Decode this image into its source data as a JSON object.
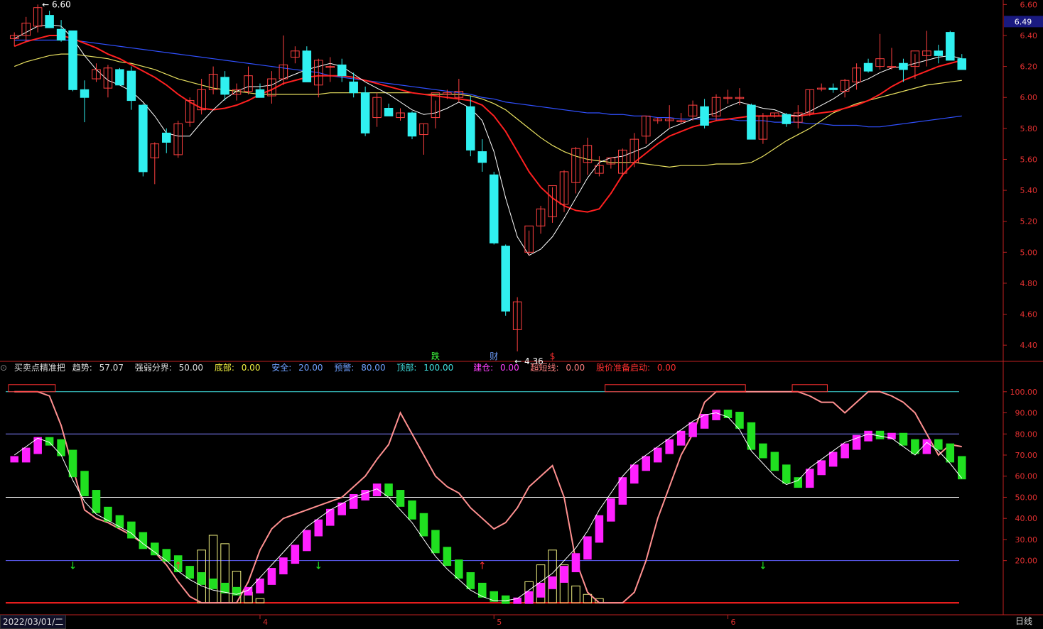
{
  "colors": {
    "background": "#000000",
    "axis": "#c02020",
    "candle_up": "#ff4040",
    "candle_down": "#30f0f0",
    "ma5": "#ffffff",
    "ma10": "#ff2020",
    "ma20": "#e8e060",
    "ma60": "#3050ff",
    "trend_up": "#ff20ff",
    "trend_down": "#20e020",
    "oscillator_line": "#ff9090",
    "signal_line": "#ffffff",
    "bottom_bars": "#f0f080"
  },
  "header": {
    "indicator_name": "买卖点精准把",
    "trend_label": "趋势:",
    "trend_value": "57.07",
    "strength_label": "强弱分界:",
    "strength_value": "50.00",
    "bottom_label": "底部:",
    "bottom_value": "0.00",
    "safe_label": "安全:",
    "safe_value": "20.00",
    "warn_label": "预警:",
    "warn_value": "80.00",
    "top_label": "顶部:",
    "top_value": "100.00",
    "build_label": "建仓:",
    "build_value": "0.00",
    "short_label": "超短线:",
    "short_value": "0.00",
    "launch_label": "股价准备启动:",
    "launch_value": "0.00"
  },
  "footer": {
    "start_date": "2022/03/01/二",
    "period": "日线"
  },
  "chart_data": [
    {
      "type": "candlestick",
      "ylim": [
        4.3,
        6.62
      ],
      "y_ticks": [
        "6.60",
        "6.40",
        "6.20",
        "6.00",
        "5.80",
        "5.60",
        "5.40",
        "5.20",
        "5.00",
        "4.80",
        "4.60",
        "4.40"
      ],
      "x_ticks": [
        "4",
        "5",
        "6"
      ],
      "last_price": "6.49",
      "high_label": "6.60",
      "low_label": "4.36",
      "markers": [
        "跌",
        "财",
        "$"
      ],
      "candles": [
        [
          6.38,
          6.42,
          6.33,
          6.4
        ],
        [
          6.4,
          6.52,
          6.36,
          6.48
        ],
        [
          6.46,
          6.6,
          6.42,
          6.58
        ],
        [
          6.53,
          6.56,
          6.45,
          6.45
        ],
        [
          6.44,
          6.5,
          6.36,
          6.37
        ],
        [
          6.43,
          6.43,
          6.04,
          6.05
        ],
        [
          6.05,
          6.11,
          5.84,
          6.0
        ],
        [
          6.12,
          6.22,
          6.1,
          6.18
        ],
        [
          6.06,
          6.21,
          6.0,
          6.19
        ],
        [
          6.18,
          6.19,
          6.08,
          6.08
        ],
        [
          6.17,
          6.2,
          5.92,
          5.98
        ],
        [
          5.95,
          5.96,
          5.49,
          5.52
        ],
        [
          5.61,
          5.71,
          5.44,
          5.7
        ],
        [
          5.77,
          5.8,
          5.64,
          5.71
        ],
        [
          5.63,
          5.85,
          5.61,
          5.83
        ],
        [
          5.84,
          6.0,
          5.81,
          5.98
        ],
        [
          5.92,
          6.12,
          5.89,
          6.05
        ],
        [
          6.05,
          6.2,
          6.02,
          6.15
        ],
        [
          6.13,
          6.17,
          5.98,
          6.02
        ],
        [
          6.02,
          6.09,
          5.98,
          6.05
        ],
        [
          6.04,
          6.2,
          6.02,
          6.14
        ],
        [
          6.05,
          6.09,
          6.0,
          6.0
        ],
        [
          6.01,
          6.17,
          5.96,
          6.12
        ],
        [
          6.12,
          6.4,
          6.08,
          6.21
        ],
        [
          6.26,
          6.33,
          6.22,
          6.3
        ],
        [
          6.3,
          6.33,
          6.1,
          6.1
        ],
        [
          6.08,
          6.25,
          6.0,
          6.24
        ],
        [
          6.2,
          6.26,
          6.1,
          6.2
        ],
        [
          6.21,
          6.25,
          6.1,
          6.14
        ],
        [
          6.1,
          6.16,
          6.0,
          6.03
        ],
        [
          6.03,
          6.07,
          5.75,
          5.77
        ],
        [
          5.87,
          6.03,
          5.81,
          6.0
        ],
        [
          5.93,
          5.96,
          5.88,
          5.88
        ],
        [
          5.87,
          5.93,
          5.85,
          5.9
        ],
        [
          5.9,
          5.91,
          5.73,
          5.75
        ],
        [
          5.76,
          5.83,
          5.63,
          5.83
        ],
        [
          5.87,
          5.98,
          5.8,
          6.03
        ],
        [
          6.02,
          6.05,
          5.99,
          6.03
        ],
        [
          6.0,
          6.12,
          5.97,
          6.04
        ],
        [
          5.94,
          6.01,
          5.62,
          5.66
        ],
        [
          5.65,
          5.73,
          5.52,
          5.58
        ],
        [
          5.5,
          5.52,
          5.05,
          5.06
        ],
        [
          5.04,
          5.05,
          4.59,
          4.62
        ],
        [
          4.5,
          4.71,
          4.36,
          4.68
        ],
        [
          5.0,
          5.14,
          4.98,
          5.17
        ],
        [
          5.17,
          5.3,
          5.12,
          5.28
        ],
        [
          5.23,
          5.42,
          5.19,
          5.43
        ],
        [
          5.31,
          5.53,
          5.26,
          5.52
        ],
        [
          5.45,
          5.68,
          5.38,
          5.67
        ],
        [
          5.58,
          5.74,
          5.5,
          5.69
        ],
        [
          5.51,
          5.62,
          5.49,
          5.56
        ],
        [
          5.57,
          5.61,
          5.54,
          5.61
        ],
        [
          5.51,
          5.67,
          5.49,
          5.66
        ],
        [
          5.58,
          5.77,
          5.55,
          5.73
        ],
        [
          5.75,
          5.88,
          5.7,
          5.88
        ],
        [
          5.85,
          5.87,
          5.83,
          5.86
        ],
        [
          5.85,
          5.95,
          5.8,
          5.86
        ],
        [
          5.85,
          5.9,
          5.83,
          5.85
        ],
        [
          5.88,
          5.98,
          5.85,
          5.95
        ],
        [
          5.94,
          5.99,
          5.8,
          5.82
        ],
        [
          5.88,
          6.02,
          5.85,
          6.0
        ],
        [
          6.0,
          6.05,
          5.96,
          6.0
        ],
        [
          6.0,
          6.06,
          5.95,
          6.0
        ],
        [
          5.95,
          5.96,
          5.74,
          5.73
        ],
        [
          5.73,
          5.9,
          5.7,
          5.88
        ],
        [
          5.88,
          5.9,
          5.87,
          5.9
        ],
        [
          5.89,
          5.9,
          5.81,
          5.83
        ],
        [
          5.84,
          5.95,
          5.8,
          5.9
        ],
        [
          5.9,
          6.05,
          5.88,
          6.05
        ],
        [
          6.06,
          6.09,
          6.04,
          6.06
        ],
        [
          6.06,
          6.09,
          6.03,
          6.05
        ],
        [
          6.04,
          6.12,
          6.0,
          6.11
        ],
        [
          6.1,
          6.22,
          6.05,
          6.19
        ],
        [
          6.22,
          6.25,
          6.16,
          6.17
        ],
        [
          6.2,
          6.41,
          6.18,
          6.25
        ],
        [
          6.2,
          6.32,
          6.18,
          6.2
        ],
        [
          6.22,
          6.25,
          6.1,
          6.18
        ],
        [
          6.2,
          6.28,
          6.12,
          6.3
        ],
        [
          6.27,
          6.43,
          6.2,
          6.3
        ],
        [
          6.3,
          6.34,
          6.22,
          6.27
        ],
        [
          6.42,
          6.43,
          6.26,
          6.24
        ],
        [
          6.25,
          6.28,
          6.19,
          6.18
        ]
      ],
      "ma5": [
        6.38,
        6.42,
        6.46,
        6.47,
        6.46,
        6.38,
        6.27,
        6.18,
        6.11,
        6.08,
        6.04,
        5.97,
        5.88,
        5.77,
        5.75,
        5.75,
        5.84,
        5.92,
        5.99,
        6.04,
        6.07,
        6.07,
        6.08,
        6.12,
        6.15,
        6.18,
        6.2,
        6.22,
        6.2,
        6.15,
        6.1,
        6.06,
        6.02,
        5.97,
        5.92,
        5.89,
        5.9,
        5.93,
        5.97,
        5.93,
        5.85,
        5.65,
        5.35,
        5.1,
        4.98,
        5.02,
        5.1,
        5.22,
        5.35,
        5.48,
        5.58,
        5.61,
        5.62,
        5.65,
        5.68,
        5.74,
        5.8,
        5.83,
        5.86,
        5.88,
        5.9,
        5.94,
        5.97,
        5.95,
        5.93,
        5.92,
        5.89,
        5.88,
        5.91,
        5.95,
        5.99,
        6.04,
        6.09,
        6.12,
        6.16,
        6.19,
        6.2,
        6.22,
        6.24,
        6.26,
        6.27,
        6.25
      ],
      "ma10": [
        6.33,
        6.36,
        6.38,
        6.4,
        6.4,
        6.38,
        6.35,
        6.32,
        6.28,
        6.25,
        6.21,
        6.17,
        6.13,
        6.08,
        6.02,
        5.97,
        5.93,
        5.92,
        5.93,
        5.95,
        5.98,
        6.02,
        6.05,
        6.09,
        6.11,
        6.13,
        6.14,
        6.14,
        6.14,
        6.13,
        6.11,
        6.09,
        6.07,
        6.05,
        6.03,
        6.02,
        6.01,
        6.0,
        5.99,
        5.98,
        5.95,
        5.88,
        5.78,
        5.65,
        5.52,
        5.42,
        5.35,
        5.3,
        5.27,
        5.26,
        5.28,
        5.38,
        5.5,
        5.58,
        5.64,
        5.7,
        5.75,
        5.78,
        5.81,
        5.83,
        5.85,
        5.86,
        5.87,
        5.88,
        5.88,
        5.88,
        5.88,
        5.88,
        5.89,
        5.9,
        5.91,
        5.93,
        5.95,
        5.98,
        6.02,
        6.07,
        6.11,
        6.14,
        6.17,
        6.2,
        6.22,
        6.24
      ],
      "ma20": [
        6.2,
        6.23,
        6.25,
        6.27,
        6.28,
        6.28,
        6.27,
        6.26,
        6.25,
        6.23,
        6.22,
        6.2,
        6.18,
        6.15,
        6.12,
        6.1,
        6.08,
        6.06,
        6.05,
        6.04,
        6.03,
        6.02,
        6.02,
        6.02,
        6.02,
        6.02,
        6.02,
        6.03,
        6.03,
        6.03,
        6.03,
        6.03,
        6.03,
        6.03,
        6.03,
        6.02,
        6.02,
        6.02,
        6.02,
        6.01,
        5.99,
        5.96,
        5.92,
        5.86,
        5.8,
        5.74,
        5.69,
        5.65,
        5.62,
        5.6,
        5.59,
        5.58,
        5.58,
        5.58,
        5.57,
        5.56,
        5.55,
        5.56,
        5.56,
        5.56,
        5.57,
        5.57,
        5.57,
        5.58,
        5.62,
        5.67,
        5.72,
        5.76,
        5.8,
        5.85,
        5.9,
        5.93,
        5.96,
        5.98,
        6.0,
        6.02,
        6.04,
        6.06,
        6.08,
        6.09,
        6.1,
        6.11
      ],
      "ma60": [
        6.37,
        6.37,
        6.37,
        6.37,
        6.37,
        6.37,
        6.36,
        6.35,
        6.34,
        6.33,
        6.32,
        6.31,
        6.3,
        6.29,
        6.28,
        6.27,
        6.26,
        6.25,
        6.24,
        6.23,
        6.22,
        6.21,
        6.2,
        6.19,
        6.18,
        6.17,
        6.16,
        6.14,
        6.13,
        6.12,
        6.11,
        6.1,
        6.09,
        6.08,
        6.07,
        6.06,
        6.05,
        6.04,
        6.03,
        6.02,
        6.0,
        5.99,
        5.97,
        5.96,
        5.95,
        5.94,
        5.93,
        5.92,
        5.91,
        5.9,
        5.9,
        5.89,
        5.89,
        5.88,
        5.88,
        5.87,
        5.87,
        5.86,
        5.86,
        5.86,
        5.86,
        5.86,
        5.85,
        5.85,
        5.85,
        5.84,
        5.84,
        5.84,
        5.83,
        5.83,
        5.82,
        5.82,
        5.82,
        5.81,
        5.81,
        5.82,
        5.83,
        5.84,
        5.85,
        5.86,
        5.87,
        5.88
      ]
    },
    {
      "type": "bar",
      "ylim": [
        -5,
        108
      ],
      "y_ticks": [
        "100.00",
        "90.00",
        "80.00",
        "70.00",
        "60.00",
        "50.00",
        "40.00",
        "30.00",
        "20.00"
      ],
      "reference_levels": [
        0,
        20,
        50,
        80,
        100
      ],
      "trend": [
        68,
        72,
        77,
        76,
        71,
        61,
        52,
        44,
        40,
        37,
        32,
        27,
        24,
        21,
        16,
        13,
        10,
        8,
        6,
        5,
        6,
        10,
        15,
        20,
        26,
        33,
        38,
        43,
        46,
        50,
        52,
        55,
        52,
        47,
        41,
        33,
        25,
        19,
        13,
        8,
        4,
        2,
        1,
        1,
        4,
        8,
        11,
        16,
        22,
        30,
        40,
        48,
        58,
        64,
        68,
        72,
        76,
        80,
        84,
        88,
        90,
        89,
        84,
        74,
        70,
        64,
        58,
        56,
        62,
        66,
        70,
        74,
        78,
        80,
        79,
        79,
        76,
        72,
        76,
        74,
        68,
        60
      ],
      "oscillator": [
        100,
        100,
        100,
        98,
        84,
        64,
        44,
        40,
        38,
        35,
        32,
        28,
        24,
        18,
        10,
        3,
        0,
        0,
        0,
        0,
        10,
        25,
        35,
        40,
        42,
        44,
        46,
        48,
        50,
        55,
        60,
        68,
        75,
        90,
        80,
        70,
        60,
        55,
        52,
        45,
        40,
        35,
        38,
        45,
        55,
        60,
        65,
        50,
        20,
        5,
        0,
        0,
        0,
        5,
        20,
        40,
        55,
        70,
        80,
        95,
        100,
        100,
        100,
        100,
        100,
        100,
        100,
        100,
        98,
        95,
        95,
        90,
        95,
        100,
        100,
        98,
        95,
        90,
        80,
        70,
        75,
        74
      ],
      "signal": [
        70,
        74,
        78,
        76,
        70,
        58,
        48,
        42,
        39,
        36,
        33,
        28,
        24,
        20,
        15,
        11,
        8,
        6,
        5,
        4,
        6,
        12,
        18,
        24,
        30,
        36,
        40,
        44,
        47,
        50,
        52,
        54,
        50,
        44,
        38,
        30,
        22,
        16,
        11,
        6,
        3,
        1,
        1,
        2,
        6,
        10,
        14,
        20,
        26,
        34,
        44,
        52,
        60,
        66,
        70,
        74,
        78,
        82,
        86,
        89,
        90,
        88,
        82,
        72,
        66,
        60,
        56,
        58,
        64,
        68,
        72,
        76,
        78,
        80,
        79,
        78,
        74,
        70,
        76,
        72,
        66,
        59
      ],
      "bottom_bars": [
        0,
        0,
        0,
        0,
        0,
        0,
        0,
        0,
        0,
        0,
        0,
        0,
        0,
        0,
        0,
        0,
        25,
        32,
        28,
        15,
        5,
        2,
        0,
        0,
        0,
        0,
        0,
        0,
        0,
        0,
        0,
        0,
        0,
        0,
        0,
        0,
        0,
        0,
        0,
        0,
        0,
        0,
        0,
        0,
        10,
        18,
        25,
        18,
        8,
        4,
        2,
        0,
        0,
        0,
        0,
        0,
        0,
        0,
        0,
        0,
        0,
        0,
        0,
        0,
        0,
        0,
        0,
        0,
        0,
        0,
        0,
        0,
        0,
        0,
        0,
        0,
        0,
        0,
        0,
        0,
        0,
        0
      ]
    }
  ]
}
